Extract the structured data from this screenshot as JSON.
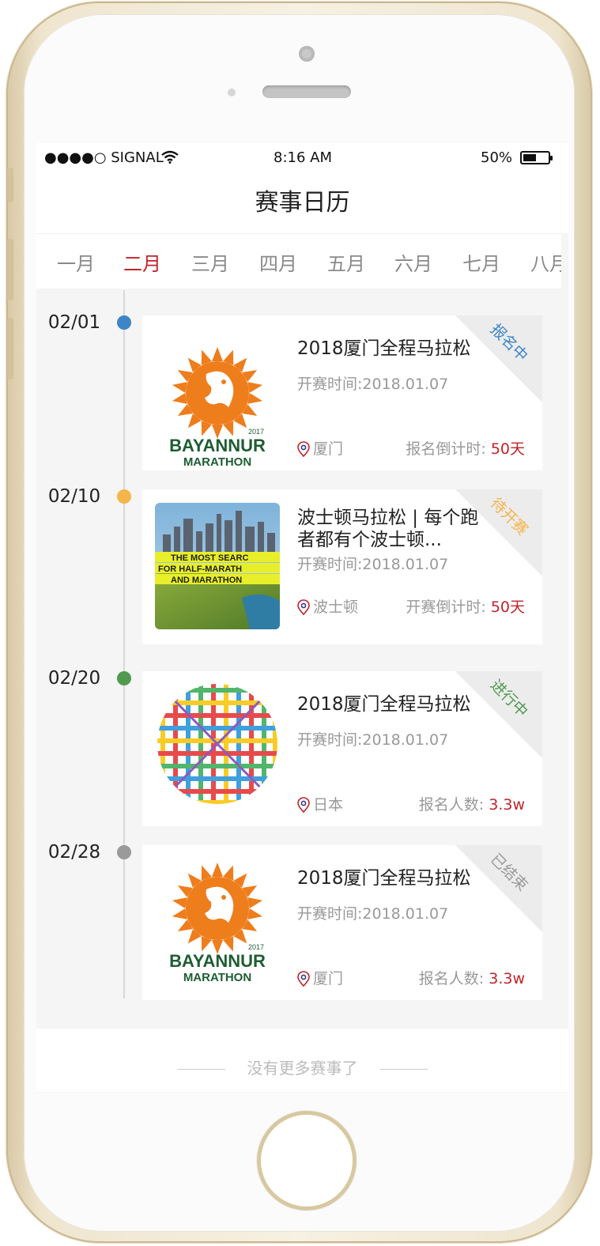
{
  "status": {
    "signal": "●●●●○ SIGNAL",
    "time": "8:16 AM",
    "battery": "50%"
  },
  "title": "赛事日历",
  "months": [
    "一月",
    "二月",
    "三月",
    "四月",
    "五月",
    "六月",
    "七月",
    "八月"
  ],
  "active_month": "二月",
  "events": [
    {
      "date": "02/01",
      "dot_color": "#3d85c6",
      "name": "2018厦门全程马拉松",
      "start": "开赛时间:2018.01.07",
      "location": "厦门",
      "meta_label": "报名倒计时:",
      "meta_value": "50天",
      "status": "报名中",
      "status_color": "#3d85c6",
      "logo_year": "2017",
      "logo_line1": "BAYANNUR",
      "logo_line2": "MARATHON"
    },
    {
      "date": "02/10",
      "dot_color": "#f4b54a",
      "name": "波士顿马拉松 | 每个跑者都有个波士顿...",
      "start": "开赛时间:2018.01.07",
      "location": "波士顿",
      "meta_label": "开赛倒计时:",
      "meta_value": "50天",
      "status": "待开赛",
      "status_color": "#f4b54a",
      "photo_text": [
        "THE MOST SEARC",
        "FOR HALF-MARATH",
        "AND MARATHON"
      ]
    },
    {
      "date": "02/20",
      "dot_color": "#4f9a4f",
      "name": "2018厦门全程马拉松",
      "start": "开赛时间:2018.01.07",
      "location": "日本",
      "meta_label": "报名人数:",
      "meta_value": "3.3w",
      "status": "进行中",
      "status_color": "#4f9a4f"
    },
    {
      "date": "02/28",
      "dot_color": "#9a9a9a",
      "name": "2018厦门全程马拉松",
      "start": "开赛时间:2018.01.07",
      "location": "厦门",
      "meta_label": "报名人数:",
      "meta_value": "3.3w",
      "status": "已结束",
      "status_color": "#9a9a9a",
      "logo_year": "2017",
      "logo_line1": "BAYANNUR",
      "logo_line2": "MARATHON"
    }
  ],
  "footer": "没有更多赛事了"
}
